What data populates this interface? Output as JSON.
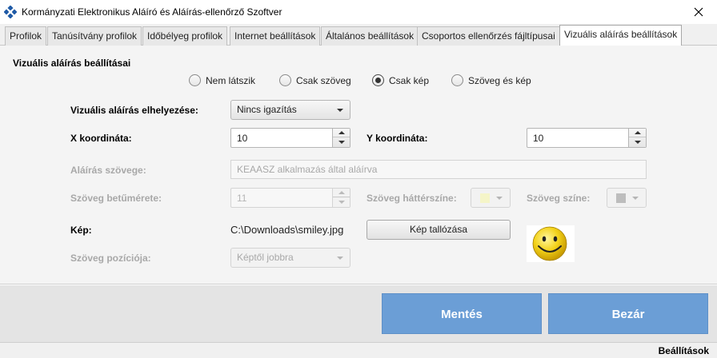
{
  "window": {
    "title": "Kormányzati Elektronikus Aláíró és Aláírás-ellenőrző Szoftver"
  },
  "tabs": [
    {
      "label": "Profilok"
    },
    {
      "label": "Tanúsítvány profilok"
    },
    {
      "label": "Időbélyeg profilok"
    },
    {
      "label": "Internet beállítások"
    },
    {
      "label": "Általános beállítások"
    },
    {
      "label": "Csoportos ellenőrzés fájltípusai"
    },
    {
      "label": "Vizuális aláírás beállítások"
    }
  ],
  "active_tab": "Vizuális aláírás beállítások",
  "section_title": "Vizuális aláírás beállításai",
  "mode_options": [
    {
      "label": "Nem látszik",
      "checked": false
    },
    {
      "label": "Csak szöveg",
      "checked": false
    },
    {
      "label": "Csak kép",
      "checked": true
    },
    {
      "label": "Szöveg és kép",
      "checked": false
    }
  ],
  "form": {
    "placement_label": "Vizuális aláírás elhelyezése:",
    "placement_value": "Nincs igazítás",
    "x_label": "X koordináta:",
    "x_value": "10",
    "y_label": "Y koordináta:",
    "y_value": "10",
    "text_label": "Aláírás szövege:",
    "text_value": "KEAASZ alkalmazás által aláírva",
    "fontsize_label": "Szöveg betűmérete:",
    "fontsize_value": "11",
    "bgcolor_label": "Szöveg háttérszíne:",
    "bgcolor_swatch": "#f5f5c8",
    "textcolor_label": "Szöveg színe:",
    "textcolor_swatch": "#bdbdbd",
    "image_label": "Kép:",
    "image_path": "C:\\Downloads\\smiley.jpg",
    "browse_label": "Kép tallózása",
    "textpos_label": "Szöveg pozíciója:",
    "textpos_value": "Képtől jobbra"
  },
  "buttons": {
    "save": "Mentés",
    "close": "Bezár"
  },
  "status": "Beállítások",
  "colors": {
    "accent": "#6b9ed6",
    "app_icon": "#1f5aa6"
  },
  "icons": {
    "close": "close-icon",
    "app": "app-logo-icon",
    "preview": "smiley-preview"
  }
}
